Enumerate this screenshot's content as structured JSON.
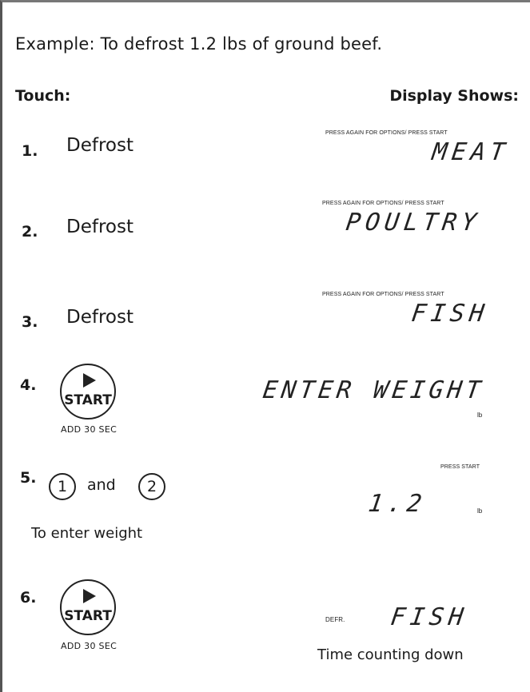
{
  "title": "Example: To defrost 1.2 lbs of ground beef.",
  "columns": {
    "touch": "Touch:",
    "display": "Display Shows:"
  },
  "steps": [
    {
      "num": "1.",
      "label": "Defrost",
      "display_caption": "PRESS AGAIN FOR OPTIONS/ PRESS START",
      "display_text": "MEAT"
    },
    {
      "num": "2.",
      "label": "Defrost",
      "display_caption": "PRESS AGAIN FOR OPTIONS/ PRESS START",
      "display_text": "POULTRY"
    },
    {
      "num": "3.",
      "label": "Defrost",
      "display_caption": "PRESS AGAIN FOR OPTIONS/ PRESS START",
      "display_text": "FISH"
    },
    {
      "num": "4.",
      "button_label": "START",
      "button_caption": "ADD 30 SEC",
      "display_text": "ENTER WEIGHT",
      "unit": "lb"
    },
    {
      "num": "5.",
      "key1": "1",
      "and_word": "and",
      "key2": "2",
      "note": "To enter weight",
      "display_caption": "PRESS START",
      "display_text": "1.2",
      "unit": "lb"
    },
    {
      "num": "6.",
      "button_label": "START",
      "button_caption": "ADD 30 SEC",
      "display_prefix": "DEFR.",
      "display_text": "FISH",
      "note": "Time counting down"
    }
  ]
}
